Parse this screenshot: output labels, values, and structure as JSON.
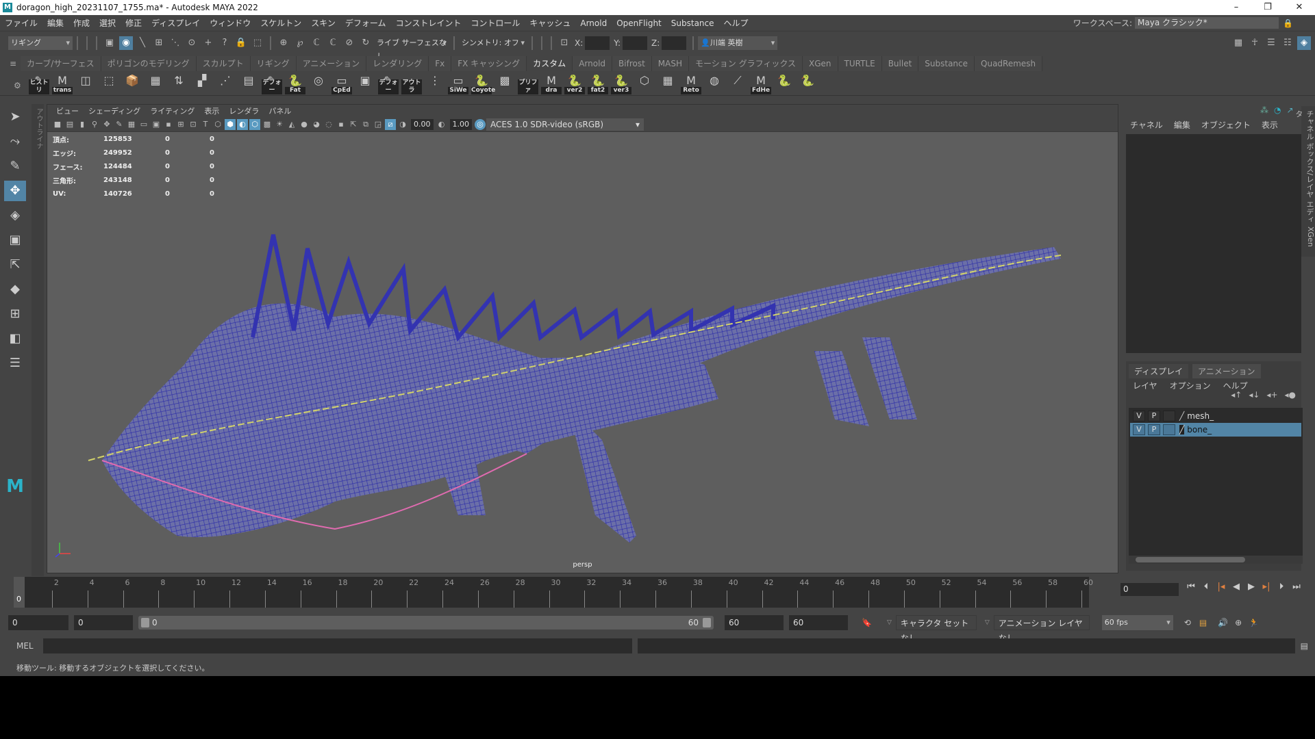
{
  "window": {
    "title": "doragon_high_20231107_1755.ma* - Autodesk MAYA 2022",
    "logo": "M",
    "min": "–",
    "max": "❐",
    "close": "✕"
  },
  "menubar": {
    "items": [
      "ファイル",
      "編集",
      "作成",
      "選択",
      "修正",
      "ディスプレイ",
      "ウィンドウ",
      "スケルトン",
      "スキン",
      "デフォーム",
      "コンストレイント",
      "コントロール",
      "キャッシュ",
      "Arnold",
      "OpenFlight",
      "Substance",
      "ヘルプ"
    ],
    "workspace_label": "ワークスペース:",
    "workspace_value": "Maya クラシック*"
  },
  "statusline": {
    "menuset": "リギング",
    "live_surface": "ライブ サーフェスなし",
    "symmetry": "シンメトリ: オフ",
    "x_label": "X:",
    "y_label": "Y:",
    "z_label": "Z:",
    "user": "川端 英樹"
  },
  "shelf": {
    "tabs": [
      "カーブ/サーフェス",
      "ポリゴンのモデリング",
      "スカルプト",
      "リギング",
      "アニメーション",
      "レンダリング",
      "Fx",
      "FX キャッシング",
      "カスタム",
      "Arnold",
      "Bifrost",
      "MASH",
      "モーション グラフィックス",
      "XGen",
      "TURTLE",
      "Bullet",
      "Substance",
      "QuadRemesh"
    ],
    "active_tab": "カスタム",
    "buttons": [
      "ヒストリ",
      "trans",
      "",
      "",
      "",
      "",
      "",
      "",
      "",
      "",
      "デフォー",
      "Fat",
      "",
      "CpEd",
      "",
      "デフォー",
      "アウトラ",
      "",
      "SiWe",
      "Coyote",
      "",
      "プリファ",
      "dra",
      "ver2",
      "fat2",
      "ver3",
      "",
      "",
      "Reto",
      "",
      "",
      "FdHe",
      "",
      ""
    ]
  },
  "viewport": {
    "menu": [
      "ビュー",
      "シェーディング",
      "ライティング",
      "表示",
      "レンダラ",
      "パネル"
    ],
    "exposure": "0.00",
    "gamma": "1.00",
    "color_space": "ACES 1.0 SDR-video (sRGB)",
    "camera": "persp",
    "hud": [
      [
        "頂点:",
        "125853",
        "0",
        "0"
      ],
      [
        "エッジ:",
        "249952",
        "0",
        "0"
      ],
      [
        "フェース:",
        "124484",
        "0",
        "0"
      ],
      [
        "三角形:",
        "243148",
        "0",
        "0"
      ],
      [
        "UV:",
        "140726",
        "0",
        "0"
      ]
    ]
  },
  "outliner_tab": "アウトライナ",
  "channelbox": {
    "menu": [
      "チャネル",
      "編集",
      "オブジェクト",
      "表示"
    ]
  },
  "layer_editor": {
    "tabs": [
      "ディスプレイ",
      "アニメーション"
    ],
    "menu": [
      "レイヤ",
      "オプション",
      "ヘルプ"
    ],
    "layers": [
      {
        "v": "V",
        "p": "P",
        "name": "mesh_",
        "selected": false
      },
      {
        "v": "V",
        "p": "P",
        "name": "bone_",
        "selected": true
      }
    ]
  },
  "side_tabs": [
    "チャネル ボックス/レイヤ エディタ",
    "XGen"
  ],
  "timeline": {
    "ticks": [
      "0",
      "2",
      "4",
      "6",
      "8",
      "10",
      "12",
      "14",
      "16",
      "18",
      "20",
      "22",
      "24",
      "26",
      "28",
      "30",
      "32",
      "34",
      "36",
      "38",
      "40",
      "42",
      "44",
      "46",
      "48",
      "50",
      "52",
      "54",
      "56",
      "58",
      "60"
    ],
    "current": "0",
    "current_field": "0"
  },
  "range": {
    "anim_start": "0",
    "play_start": "0",
    "slider_start": "0",
    "slider_end": "60",
    "play_end": "60",
    "anim_end": "60",
    "character_set": "キャラクタ セットなし",
    "anim_layer": "アニメーション レイヤなし",
    "fps": "60 fps"
  },
  "mel": {
    "label": "MEL"
  },
  "help": "移動ツール: 移動するオブジェクトを選択してください。",
  "colors": {
    "accent": "#5285a6",
    "wire": "#3a3acc",
    "viewport": "#5e5e5e"
  }
}
